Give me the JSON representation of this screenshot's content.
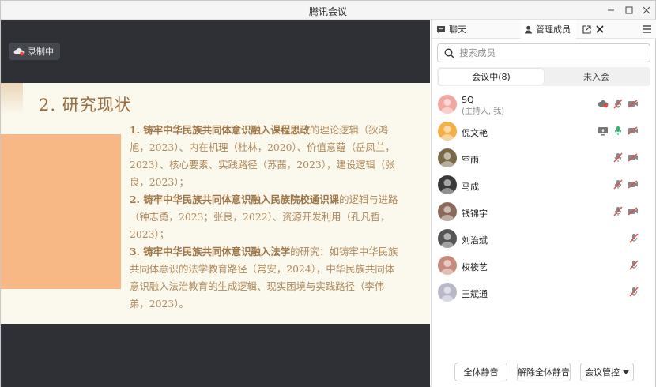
{
  "window": {
    "title": "腾讯会议"
  },
  "recording": {
    "label": "录制中"
  },
  "slide": {
    "title": "2. 研究现状",
    "paragraphs": [
      {
        "bold": "1. 铸牢中华民族共同体意识融入课程思政",
        "rest": "的理论逻辑（狄鸿旭，2023）、内在机理（杜林，2020）、价值意蕴（岳凤兰，2023）、核心要素、实践路径（苏茜，2023），建设逻辑（张良，2023）；"
      },
      {
        "bold": "2. 铸牢中华民族共同体意识融入民族院校通识课",
        "rest": "的逻辑与进路（钟志勇，2023；张良，2022）、资源开发利用（孔凡哲，2023）；"
      },
      {
        "bold": "3. 铸牢中华民族共同体意识融入法学",
        "rest": "的研究：如铸牢中华民族共同体意识的法学教育路径（常安，2024），中华民族共同体意识融入法治教育的生成逻辑、现实困境与实践路径（李伟弟，2023）。"
      }
    ]
  },
  "panel": {
    "tabs": [
      {
        "label": "聊天",
        "icon": "chat-icon"
      },
      {
        "label": "管理成员",
        "icon": "user-icon"
      }
    ],
    "search": {
      "placeholder": "搜索成员"
    },
    "segments": [
      {
        "label": "会议中(8)",
        "active": true
      },
      {
        "label": "未入会",
        "active": false
      }
    ],
    "members": [
      {
        "name": "SQ",
        "role": "(主持人, 我)",
        "avatar_color": "#f0a8a0",
        "icons": [
          "cloud-record-icon",
          "mic-muted-icon",
          "camera-off-icon"
        ]
      },
      {
        "name": "倪文艳",
        "role": "",
        "avatar_color": "#f3b04a",
        "icons": [
          "screen-share-icon",
          "mic-on-icon",
          "camera-off-icon"
        ]
      },
      {
        "name": "空雨",
        "role": "",
        "avatar_color": "#7a6a4a",
        "icons": [
          "mic-muted-icon",
          "camera-off-icon"
        ]
      },
      {
        "name": "马成",
        "role": "",
        "avatar_color": "#3a3a3a",
        "icons": [
          "mic-muted-icon",
          "camera-off-icon"
        ]
      },
      {
        "name": "钱锦宇",
        "role": "",
        "avatar_color": "#8a6a5a",
        "icons": [
          "mic-muted-icon",
          "camera-off-icon"
        ]
      },
      {
        "name": "刘治斌",
        "role": "",
        "avatar_color": "#555555",
        "icons": [
          "mic-muted-icon"
        ]
      },
      {
        "name": "权筱艺",
        "role": "",
        "avatar_color": "#c88a7a",
        "icons": [
          "mic-muted-icon"
        ]
      },
      {
        "name": "王斌通",
        "role": "",
        "avatar_color": "#b8b8c8",
        "icons": [
          "mic-muted-icon"
        ]
      }
    ],
    "footer": {
      "mute_all": "全体静音",
      "unmute_all": "解除全体静音",
      "control": "会议管控"
    }
  },
  "colors": {
    "muted_red": "#d9534f",
    "accent_green": "#2bb673",
    "slide_title": "#9a6b3a",
    "slide_text": "#b08a5a",
    "slide_block": "#f7b886"
  }
}
